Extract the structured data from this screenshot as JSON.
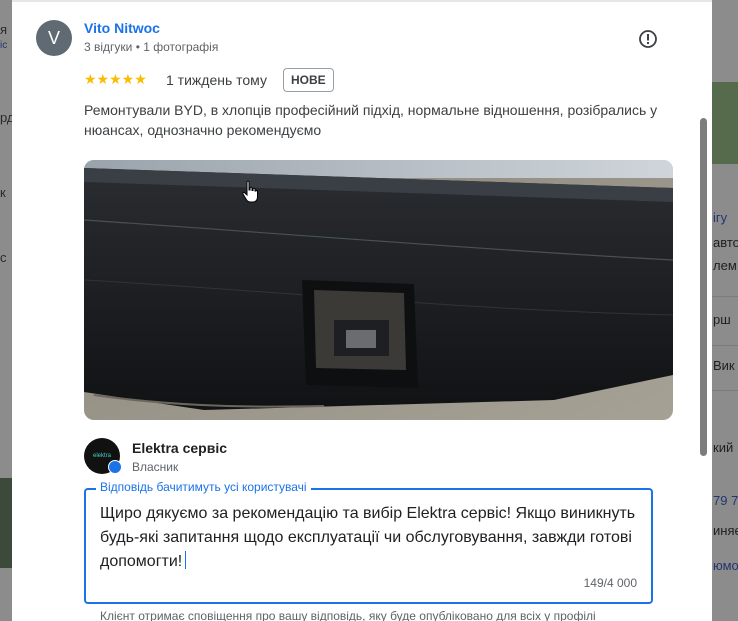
{
  "background": {
    "left_fragments": [
      "я",
      "ic",
      "рд",
      "к",
      "с"
    ],
    "right_fragments": [
      "ігу",
      "авто",
      "лем",
      "рш",
      "Вик",
      "кий",
      "79 79",
      "иняє",
      "юмо"
    ]
  },
  "review": {
    "author_initial": "V",
    "author_name": "Vito Nitwoc",
    "author_meta": "3 відгуки • 1 фотографія",
    "stars": "★★★★★",
    "time": "1 тиждень тому",
    "badge": "НОВЕ",
    "text": "Ремонтували BYD, в хлопців професійний підхід, нормальне відношення, розібрались у нюансах, однозначно рекомендуємо",
    "flag_icon": "report-flag-icon"
  },
  "owner": {
    "logo_text": "elektra",
    "name": "Elektra сервіс",
    "role": "Власник"
  },
  "reply": {
    "label": "Відповідь бачитимуть усі користувачі",
    "text": "Щиро дякуємо за рекомендацію та вибір Elektra сервіс! Якщо виникнуть будь-які запитання щодо експлуатації чи обслуговування, завжди готові допомогти!",
    "counter": "149/4 000",
    "notice": "Клієнт отримає сповіщення про вашу відповідь, яку буде опубліковано для всіх у профілі"
  },
  "colors": {
    "accent": "#1a73e8",
    "star": "#fbbc04"
  }
}
